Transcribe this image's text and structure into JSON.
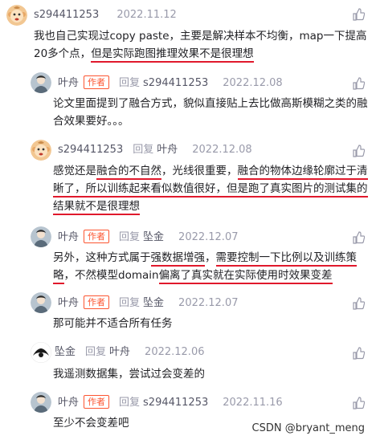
{
  "comments": [
    {
      "user": "s294411253",
      "time": "2022.11.12",
      "content_pre": "我也自己实现过copy paste，主要是解决样本不均衡，map一下提高20多个点，",
      "content_ul": "但是实际跑图推理效果不是很理想",
      "content_post": ""
    },
    {
      "user": "叶舟",
      "tag": "作者",
      "reply_label": "回复",
      "target": "s294411253",
      "time": "2022.12.08",
      "content": "论文里面提到了融合方式，貌似直接贴上去比做高斯模糊之类的融合效果要好。。。"
    },
    {
      "user": "s294411253",
      "reply_label": "回复",
      "target": "叶舟",
      "time": "2022.12.08",
      "content_a": "感觉还是",
      "content_b": "融合的不自然",
      "content_c": "，光线很重要，",
      "content_d": "融合的物体边缘轮廓过于清晰了",
      "content_e": "，所以训练起来看似数值很好，但是跑了真实图片的测试集的结果就不是很理想"
    },
    {
      "user": "叶舟",
      "tag": "作者",
      "reply_label": "回复",
      "target": "坠金",
      "time": "2022.12.07",
      "content_a": "另外，这种方式属于",
      "content_b": "强数据增强",
      "content_c": "，",
      "content_d": "需要控制一下比例以及训练策略",
      "content_e": "，不然模型domain",
      "content_f": "偏离了真实就在实际使用时效果变差"
    },
    {
      "user": "叶舟",
      "tag": "作者",
      "reply_label": "回复",
      "target": "坠金",
      "time": "2022.12.07",
      "content": "那可能并不适合所有任务"
    },
    {
      "user": "坠金",
      "reply_label": "回复",
      "target": "叶舟",
      "time": "2022.12.06",
      "content": "我遥测数据集，尝试过会变差的"
    },
    {
      "user": "叶舟",
      "tag": "作者",
      "reply_label": "回复",
      "target": "s294411253",
      "time": "2022.11.16",
      "content": "至少不会变差吧"
    }
  ],
  "watermark": "CSDN @bryant_meng",
  "colors": {
    "underline": "#e0192c",
    "author_tag": "#fc5531"
  }
}
